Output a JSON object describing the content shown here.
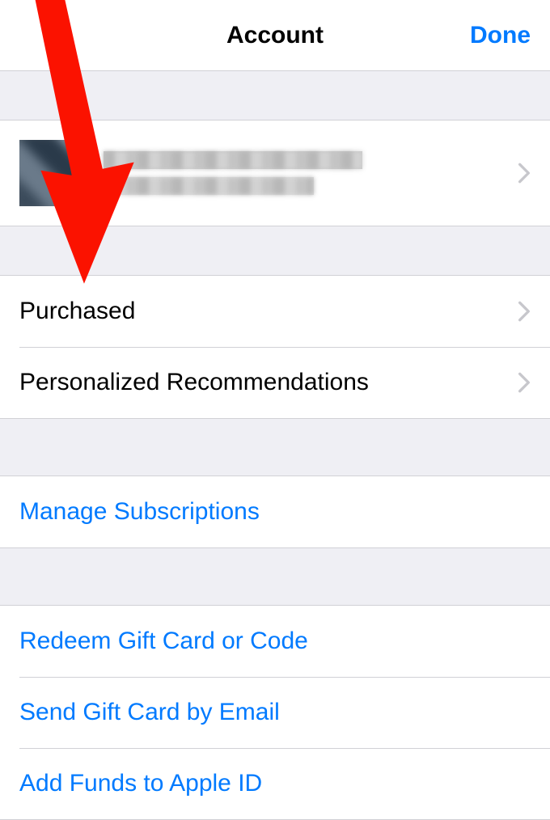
{
  "header": {
    "title": "Account",
    "done": "Done"
  },
  "sections": {
    "purchased": "Purchased",
    "recommendations": "Personalized Recommendations",
    "manage_subscriptions": "Manage Subscriptions",
    "redeem": "Redeem Gift Card or Code",
    "send_gift": "Send Gift Card by Email",
    "add_funds": "Add Funds to Apple ID"
  }
}
